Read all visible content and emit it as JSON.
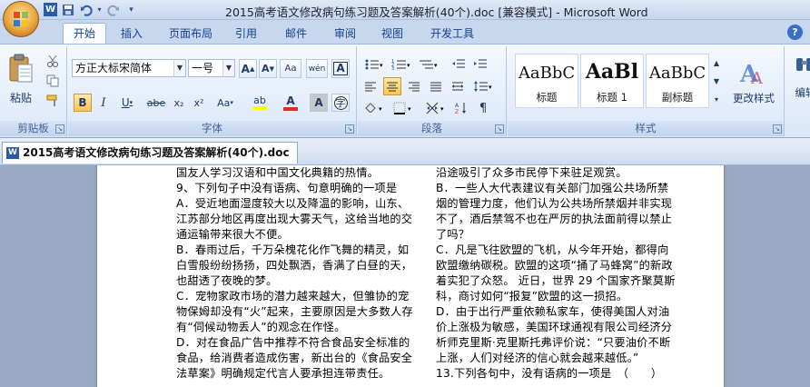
{
  "window": {
    "title": "2015高考语文修改病句练习题及答案解析(40个).doc [兼容模式] - Microsoft Word"
  },
  "quick_access": {
    "icons": [
      "word-icon",
      "save-icon",
      "undo-icon",
      "redo-icon",
      "customize-icon"
    ]
  },
  "tabs": [
    {
      "label": "开始",
      "active": true
    },
    {
      "label": "插入"
    },
    {
      "label": "页面布局"
    },
    {
      "label": "引用"
    },
    {
      "label": "邮件"
    },
    {
      "label": "审阅"
    },
    {
      "label": "视图"
    },
    {
      "label": "开发工具"
    }
  ],
  "ribbon": {
    "clipboard": {
      "label": "剪贴板",
      "paste_label": "粘贴"
    },
    "font": {
      "label": "字体",
      "font_name": "方正大标宋简体",
      "font_size": "一号",
      "grow": "A",
      "shrink": "A",
      "clear_format": "Aa",
      "phonetic": "wén",
      "border_char": "A",
      "bold": "B",
      "italic": "I",
      "underline": "U",
      "strike": "abe",
      "subscript": "x₂",
      "superscript": "x²",
      "change_case": "Aa",
      "highlight": "ab",
      "font_color": "A",
      "shade_char": "A",
      "enclose_char": "字"
    },
    "paragraph": {
      "label": "段落"
    },
    "styles": {
      "label": "样式",
      "items": [
        {
          "sample": "AaBbC",
          "name": "标题"
        },
        {
          "sample": "AaBl",
          "name": "标题 1"
        },
        {
          "sample": "AaBbC",
          "name": "副标题"
        }
      ],
      "change_styles": "更改样式"
    },
    "editing": {
      "label": "编辑"
    }
  },
  "doc_tab": {
    "title": "2015高考语文修改病句练习题及答案解析(40个).doc"
  },
  "document": {
    "left_column": [
      "国友人学习汉语和中国文化典籍的热情。",
      "9、下列句子中没有语病、句意明确的一项是",
      "A．受近地面湿度较大以及降温的影响，山东、",
      "江苏部分地区再度出现大雾天气，这给当地的交",
      "通运输带来很大不便。",
      "B．春雨过后，千万朵槐花化作飞舞的精灵，如",
      "白雪般纷纷扬扬，四处飘洒，香满了白昼的天，",
      "也甜透了夜晚的梦。",
      "C．宠物家政市场的潜力越来越大，但雏协的宠",
      "物保姆却没有“火”起来，主要原因是大多数人存",
      "有“伺候动物丢人”的观念在作怪。",
      "D．对在食品广告中推荐不符合食品安全标准的",
      "食品，给消费者造成伤害，新出台的《食品安全",
      "法草案》明确规定代言人要承担连带责任。"
    ],
    "right_column": [
      "沿途吸引了众多市民停下来驻足观赏。",
      "B．一些人大代表建议有关部门加强公共场所禁",
      "烟的管理力度，他们认为公共场所禁烟并非实现",
      "不了，酒后禁驾不也在严厉的执法面前得以禁止",
      "了吗？",
      "C．凡是飞往欧盟的飞机，从今年开始，都得向",
      "欧盟缴纳碳税。欧盟的这项“捅了马蜂窝”的新政",
      "着实犯了众怒。 近日，世界 29 个国家齐聚莫斯",
      "科，商讨如何“报复”欧盟的这一损招。",
      "D．由于出行严重依赖私家车，使得美国人对油",
      "价上涨极为敏感，美国环球通视有限公司经济分",
      "析师克里斯·克里斯托弗评价说：“只要油价不断",
      "上涨，人们对经济的信心就会越来越低。”",
      "13.下列各句中，没有语病的一项是　（　　）"
    ]
  },
  "colors": {
    "ribbon_bg": "#dbe7f7",
    "tab_text": "#15428b",
    "doc_bg": "#9aaac2"
  }
}
